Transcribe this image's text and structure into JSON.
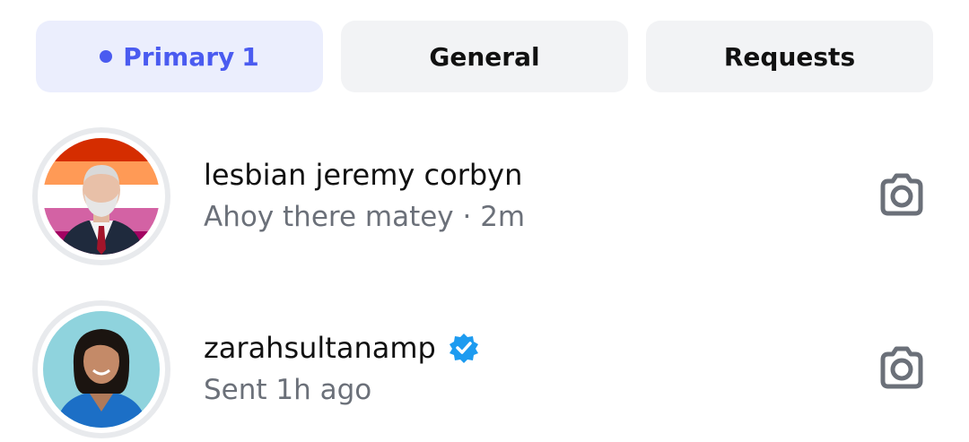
{
  "tabs": [
    {
      "label": "Primary",
      "count": "1",
      "active": true
    },
    {
      "label": "General",
      "active": false
    },
    {
      "label": "Requests",
      "active": false
    }
  ],
  "threads": [
    {
      "username": "lesbian jeremy corbyn",
      "preview": "Ahoy there matey · 2m",
      "verified": false,
      "avatar_icon": "person-photo-avatar-lesbian-flag",
      "action_icon": "camera-icon"
    },
    {
      "username": "zarahsultanamp",
      "preview": "Sent 1h ago",
      "verified": true,
      "avatar_icon": "person-photo-avatar",
      "action_icon": "camera-icon"
    }
  ],
  "colors": {
    "accent": "#4a5bf0",
    "active_tab_bg": "#ebeefd",
    "tab_bg": "#f2f3f5",
    "secondary_text": "#6b7079",
    "verified_blue": "#1d9bf0",
    "icon_gray": "#6b7079"
  }
}
